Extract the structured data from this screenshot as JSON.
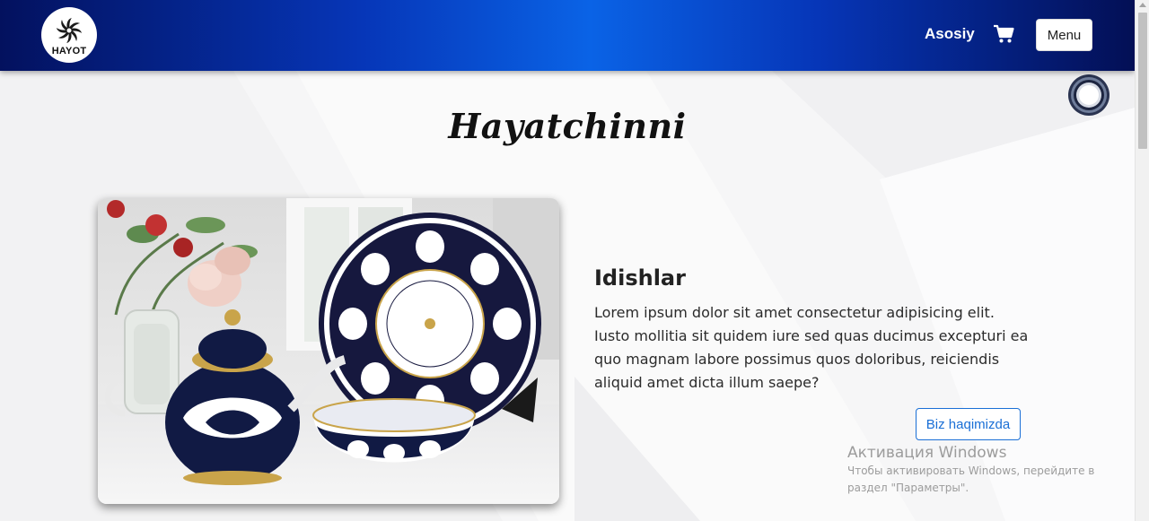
{
  "navbar": {
    "logo_text": "HAYOT",
    "home_link": "Asosiy",
    "cart_icon": "cart-icon",
    "menu_button": "Menu",
    "gradient_colors": [
      "#03115e",
      "#0a63e6",
      "#030f55"
    ]
  },
  "page": {
    "title": "Hayatchinni"
  },
  "feature": {
    "image_description_icon": "porcelain-set-image",
    "heading": "Idishlar",
    "description": "Lorem ipsum dolor sit amet consectetur adipisicing elit. Iusto mollitia sit quidem iure sed quas ducimus excepturi ea quo magnam labore possimus quos doloribus, reiciendis aliquid amet dicta illum saepe?",
    "button_label": "Biz haqimizda",
    "accent_color": "#1a6fd6"
  },
  "watermark": {
    "title": "Активация Windows",
    "line1": "Чтобы активировать Windows, перейдите в",
    "line2": "раздел \"Параметры\"."
  }
}
